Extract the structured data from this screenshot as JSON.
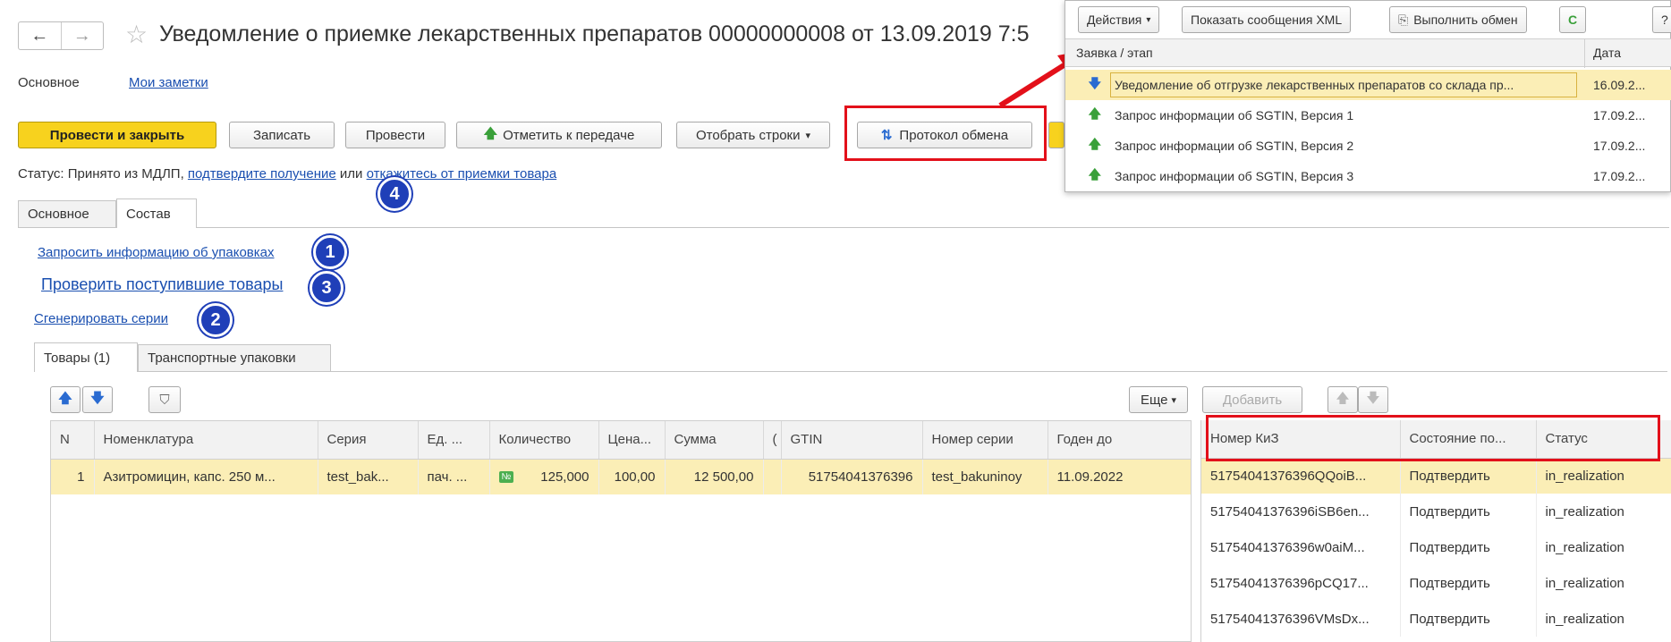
{
  "window": {
    "title": "Уведомление о приемке лекарственных препаратов 00000000008 от 13.09.2019 7:5",
    "nav_back": "←",
    "nav_forward": "→",
    "star": "☆"
  },
  "top_tabs": [
    "Основное",
    "Мои заметки"
  ],
  "toolbar": {
    "post_close": "Провести и закрыть",
    "save": "Записать",
    "post": "Провести",
    "mark_transfer": "Отметить к передаче",
    "select_rows": "Отобрать строки",
    "exchange_log": "Протокол обмена"
  },
  "status": {
    "prefix": "Статус: Принято из МДЛП, ",
    "confirm_link": "подтвердите получение",
    "or": " или ",
    "reject_link": "откажитесь от приемки товара"
  },
  "section_tabs": [
    "Основное",
    "Состав"
  ],
  "actions": {
    "request_info": "Запросить информацию об упаковках",
    "check_goods": "Проверить поступившие товары",
    "generate_series": "Сгенерировать серии"
  },
  "badges": [
    "1",
    "3",
    "2",
    "4"
  ],
  "goods_tabs": [
    "Товары (1)",
    "Транспортные упаковки"
  ],
  "goods_toolbar": {
    "more": "Еще",
    "add": "Добавить"
  },
  "goods_table": {
    "headers": [
      "N",
      "Номенклатура",
      "Серия",
      "Ед. ...",
      "Количество",
      "Цена...",
      "Сумма",
      "(",
      "GTIN",
      "Номер серии",
      "Годен до"
    ],
    "rows": [
      [
        "1",
        "Азитромицин, капс. 250 м...",
        "test_bak...",
        "пач. ...",
        "125,000",
        "100,00",
        "12 500,00",
        "",
        "51754041376396",
        "test_bakuninoy",
        "11.09.2022"
      ]
    ],
    "qty_badge": "№"
  },
  "kiz_table": {
    "headers": [
      "Номер КиЗ",
      "Состояние по...",
      "Статус"
    ],
    "rows": [
      [
        "51754041376396QQoiB...",
        "Подтвердить",
        "in_realization"
      ],
      [
        "51754041376396iSB6en...",
        "Подтвердить",
        "in_realization"
      ],
      [
        "51754041376396w0aiM...",
        "Подтвердить",
        "in_realization"
      ],
      [
        "51754041376396pCQ17...",
        "Подтвердить",
        "in_realization"
      ],
      [
        "51754041376396VMsDx...",
        "Подтвердить",
        "in_realization"
      ]
    ]
  },
  "popup": {
    "actions": "Действия",
    "show_xml": "Показать сообщения XML",
    "run_exchange": "Выполнить обмен",
    "refresh": "C",
    "help": "?",
    "col_request": "Заявка / этап",
    "col_date": "Дата",
    "rows": [
      {
        "dir": "down",
        "text": "Уведомление об отгрузке лекарственных препаратов со склада пр...",
        "date": "16.09.2..."
      },
      {
        "dir": "up",
        "text": "Запрос информации об SGTIN, Версия 1",
        "date": "17.09.2..."
      },
      {
        "dir": "up",
        "text": "Запрос информации об SGTIN, Версия 2",
        "date": "17.09.2..."
      },
      {
        "dir": "up",
        "text": "Запрос информации об SGTIN, Версия 3",
        "date": "17.09.2..."
      }
    ]
  },
  "colors": {
    "highlight": "#e3101a",
    "primary_button": "#f7d21e",
    "selected_row": "#fbeeb6",
    "badge": "#1f3fb8"
  }
}
